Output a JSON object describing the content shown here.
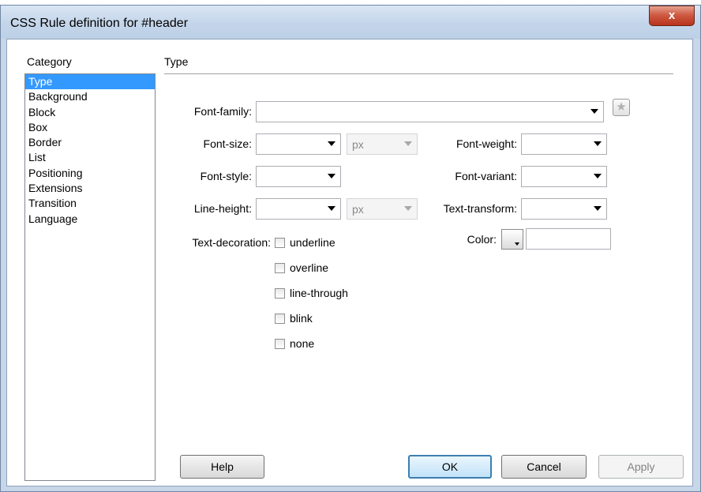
{
  "window": {
    "title": "CSS Rule definition for #header",
    "close_glyph": "x"
  },
  "category": {
    "label": "Category",
    "items": [
      "Type",
      "Background",
      "Block",
      "Box",
      "Border",
      "List",
      "Positioning",
      "Extensions",
      "Transition",
      "Language"
    ],
    "selected": "Type"
  },
  "section": {
    "title": "Type"
  },
  "fields": {
    "font_family": {
      "label": "Font-family:",
      "value": ""
    },
    "font_size": {
      "label": "Font-size:",
      "value": "",
      "unit": "px"
    },
    "font_weight": {
      "label": "Font-weight:",
      "value": ""
    },
    "font_style": {
      "label": "Font-style:",
      "value": ""
    },
    "font_variant": {
      "label": "Font-variant:",
      "value": ""
    },
    "line_height": {
      "label": "Line-height:",
      "value": "",
      "unit": "px"
    },
    "text_transform": {
      "label": "Text-transform:",
      "value": ""
    },
    "color": {
      "label": "Color:",
      "value": ""
    }
  },
  "text_decoration": {
    "label": "Text-decoration:",
    "options": [
      "underline",
      "overline",
      "line-through",
      "blink",
      "none"
    ]
  },
  "buttons": {
    "help": "Help",
    "ok": "OK",
    "cancel": "Cancel",
    "apply": "Apply"
  },
  "icons": {
    "favorite": "star-icon",
    "color_picker": "color-swatch-icon"
  },
  "colors": {
    "selection": "#3399ff",
    "close_button": "#c8472f",
    "title_bar": "#c7d6e8"
  }
}
